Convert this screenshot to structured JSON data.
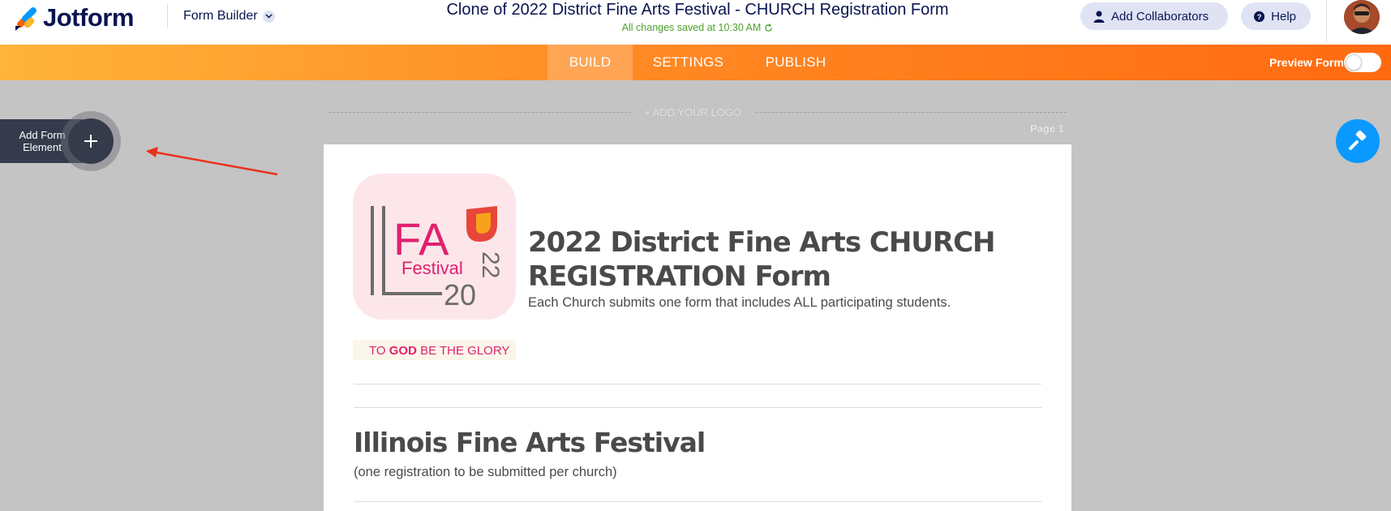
{
  "header": {
    "brand": "Jotform",
    "builder_label": "Form Builder",
    "form_title": "Clone of 2022 District Fine Arts Festival - CHURCH Registration Form",
    "saved_status": "All changes saved at 10:30 AM",
    "collaborators_label": "Add Collaborators",
    "help_label": "Help"
  },
  "tabs": [
    {
      "label": "BUILD",
      "active": true
    },
    {
      "label": "SETTINGS",
      "active": false
    },
    {
      "label": "PUBLISH",
      "active": false
    }
  ],
  "preview": {
    "label": "Preview Form",
    "enabled": false
  },
  "canvas": {
    "add_logo_label": "+ ADD YOUR LOGO",
    "page_label": "Page 1",
    "add_element_label": "Add Form Element"
  },
  "form": {
    "logo_text": {
      "top": "FA",
      "festival": "Festival",
      "year_a": "20",
      "year_b": "22",
      "motto_a": "TO ",
      "motto_b": "GOD",
      "motto_c": " BE THE GLORY"
    },
    "heading": "2022 District Fine Arts CHURCH REGISTRATION Form",
    "subheading": "Each Church submits one form that includes ALL participating students.",
    "section_heading": "Illinois Fine Arts Festival",
    "section_subheading": "(one registration to be submitted per church)"
  },
  "colors": {
    "brand_navy": "#0a1551",
    "orange_start": "#ffb43a",
    "orange_end": "#ff6a10",
    "saved_green": "#4aa22b",
    "paint_blue": "#0a99ff",
    "annotation_arrow": "#e8321e"
  },
  "icons": [
    "jotform-logo-icon",
    "chevron-down-icon",
    "user-icon",
    "help-icon",
    "refresh-icon",
    "plus-icon",
    "paint-roller-icon",
    "annotation-arrow-icon"
  ]
}
